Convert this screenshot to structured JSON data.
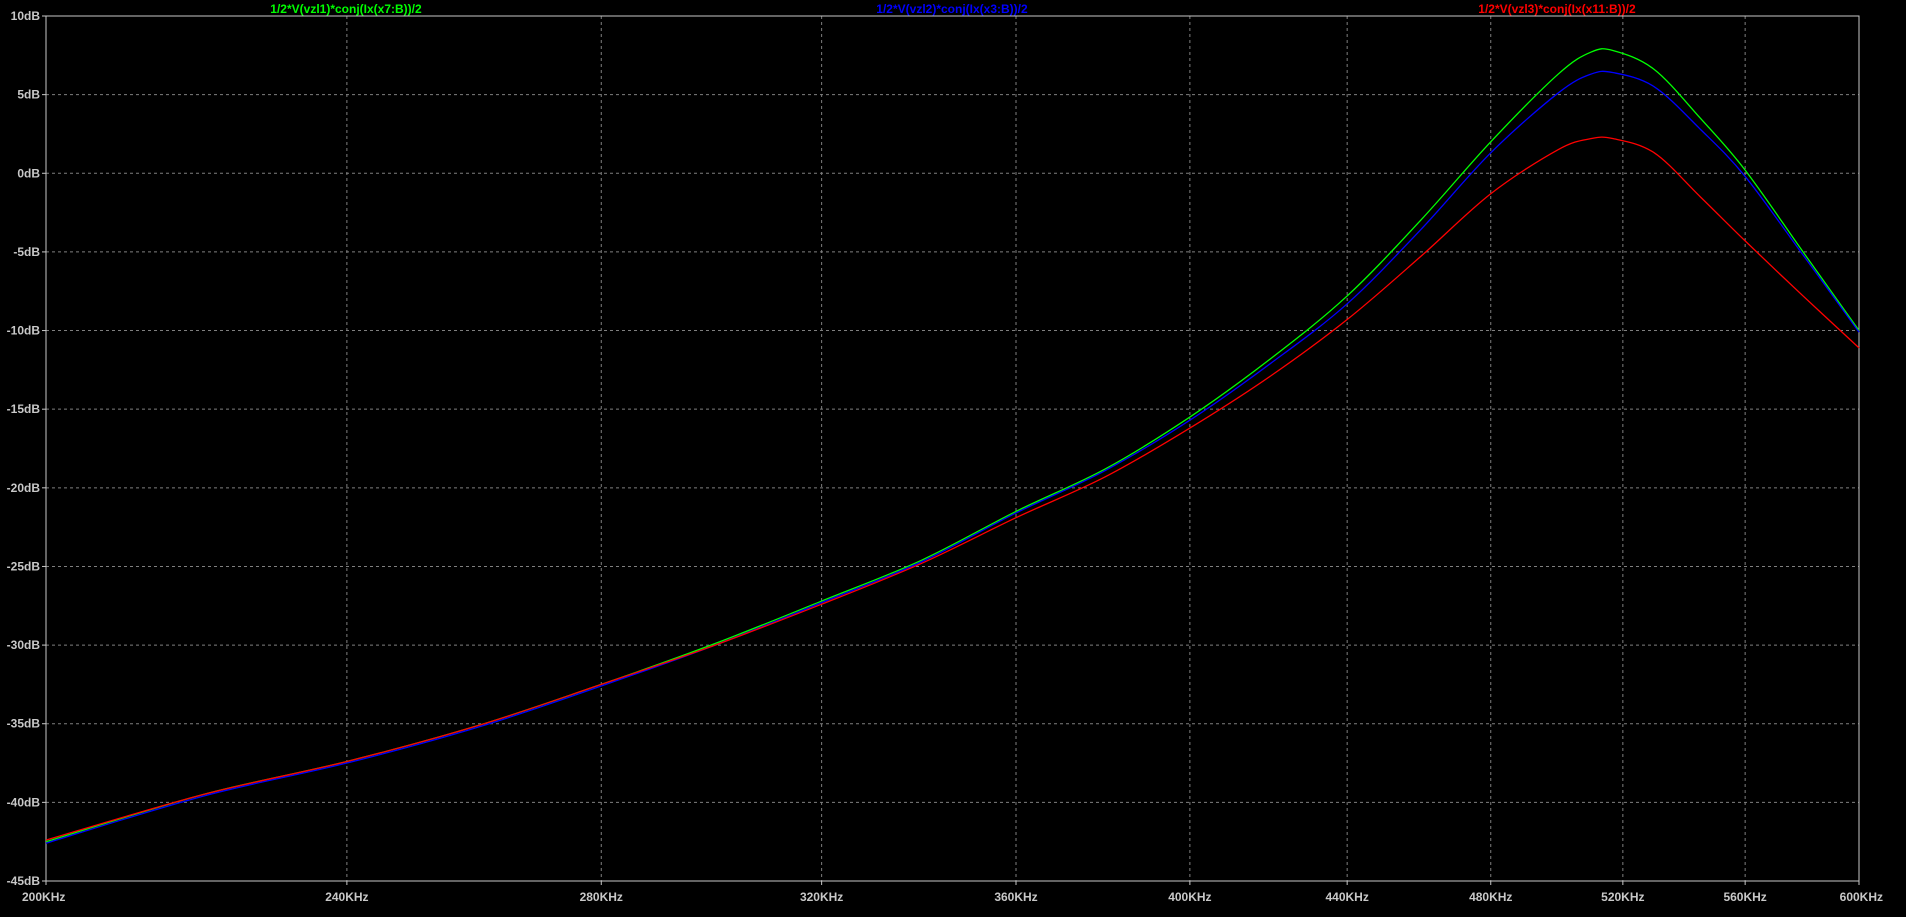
{
  "chart_data": {
    "type": "line",
    "background": "#000000",
    "grid": true,
    "grid_color": "#7f7f7f",
    "axis_color": "#c8c8c8",
    "label_color": "#c8c8c8",
    "x_scale": "log",
    "xlim": [
      200000,
      600000
    ],
    "ylim": [
      -45,
      10
    ],
    "x_ticks": [
      {
        "value": 200000,
        "label": "200KHz"
      },
      {
        "value": 240000,
        "label": "240KHz"
      },
      {
        "value": 280000,
        "label": "280KHz"
      },
      {
        "value": 320000,
        "label": "320KHz"
      },
      {
        "value": 360000,
        "label": "360KHz"
      },
      {
        "value": 400000,
        "label": "400KHz"
      },
      {
        "value": 440000,
        "label": "440KHz"
      },
      {
        "value": 480000,
        "label": "480KHz"
      },
      {
        "value": 520000,
        "label": "520KHz"
      },
      {
        "value": 560000,
        "label": "560KHz"
      },
      {
        "value": 600000,
        "label": "600KHz"
      }
    ],
    "y_ticks": [
      {
        "value": 10,
        "label": "10dB"
      },
      {
        "value": 5,
        "label": "5dB"
      },
      {
        "value": 0,
        "label": "0dB"
      },
      {
        "value": -5,
        "label": "-5dB"
      },
      {
        "value": -10,
        "label": "-10dB"
      },
      {
        "value": -15,
        "label": "-15dB"
      },
      {
        "value": -20,
        "label": "-20dB"
      },
      {
        "value": -25,
        "label": "-25dB"
      },
      {
        "value": -30,
        "label": "-30dB"
      },
      {
        "value": -35,
        "label": "-35dB"
      },
      {
        "value": -40,
        "label": "-40dB"
      },
      {
        "value": -45,
        "label": "-45dB"
      }
    ],
    "series": [
      {
        "name": "1/2*V(vzl1)*conj(Ix(x7:B))/2",
        "color": "#00ff00",
        "points": [
          [
            200000,
            -42.5
          ],
          [
            220000,
            -39.5
          ],
          [
            240000,
            -37.4
          ],
          [
            260000,
            -35.1
          ],
          [
            280000,
            -32.5
          ],
          [
            300000,
            -29.9
          ],
          [
            320000,
            -27.2
          ],
          [
            340000,
            -24.6
          ],
          [
            360000,
            -21.5
          ],
          [
            380000,
            -18.8
          ],
          [
            400000,
            -15.5
          ],
          [
            420000,
            -11.8
          ],
          [
            440000,
            -7.8
          ],
          [
            460000,
            -3.0
          ],
          [
            480000,
            2.0
          ],
          [
            500000,
            6.3
          ],
          [
            510000,
            7.7
          ],
          [
            517000,
            7.8
          ],
          [
            530000,
            6.6
          ],
          [
            545000,
            3.5
          ],
          [
            560000,
            0.2
          ],
          [
            580000,
            -5.0
          ],
          [
            600000,
            -10.0
          ]
        ]
      },
      {
        "name": "1/2*V(vzl2)*conj(Ix(x3:B))/2",
        "color": "#0000ff",
        "points": [
          [
            200000,
            -42.6
          ],
          [
            220000,
            -39.6
          ],
          [
            240000,
            -37.5
          ],
          [
            260000,
            -35.2
          ],
          [
            280000,
            -32.6
          ],
          [
            300000,
            -30.0
          ],
          [
            320000,
            -27.3
          ],
          [
            340000,
            -24.7
          ],
          [
            360000,
            -21.6
          ],
          [
            380000,
            -18.9
          ],
          [
            400000,
            -15.7
          ],
          [
            420000,
            -12.1
          ],
          [
            440000,
            -8.3
          ],
          [
            460000,
            -3.6
          ],
          [
            480000,
            1.3
          ],
          [
            500000,
            5.1
          ],
          [
            510000,
            6.3
          ],
          [
            517000,
            6.4
          ],
          [
            530000,
            5.5
          ],
          [
            545000,
            2.8
          ],
          [
            560000,
            -0.2
          ],
          [
            580000,
            -5.2
          ],
          [
            600000,
            -10.1
          ]
        ]
      },
      {
        "name": "1/2*V(vzl3)*conj(Ix(x11:B))/2",
        "color": "#ff0000",
        "points": [
          [
            200000,
            -42.4
          ],
          [
            220000,
            -39.5
          ],
          [
            240000,
            -37.4
          ],
          [
            260000,
            -35.1
          ],
          [
            280000,
            -32.5
          ],
          [
            300000,
            -30.0
          ],
          [
            320000,
            -27.4
          ],
          [
            340000,
            -24.8
          ],
          [
            360000,
            -21.9
          ],
          [
            380000,
            -19.3
          ],
          [
            400000,
            -16.2
          ],
          [
            420000,
            -12.9
          ],
          [
            440000,
            -9.3
          ],
          [
            460000,
            -5.3
          ],
          [
            480000,
            -1.3
          ],
          [
            500000,
            1.5
          ],
          [
            510000,
            2.2
          ],
          [
            517000,
            2.2
          ],
          [
            530000,
            1.3
          ],
          [
            545000,
            -1.5
          ],
          [
            560000,
            -4.3
          ],
          [
            580000,
            -7.8
          ],
          [
            600000,
            -11.1
          ]
        ]
      }
    ]
  }
}
